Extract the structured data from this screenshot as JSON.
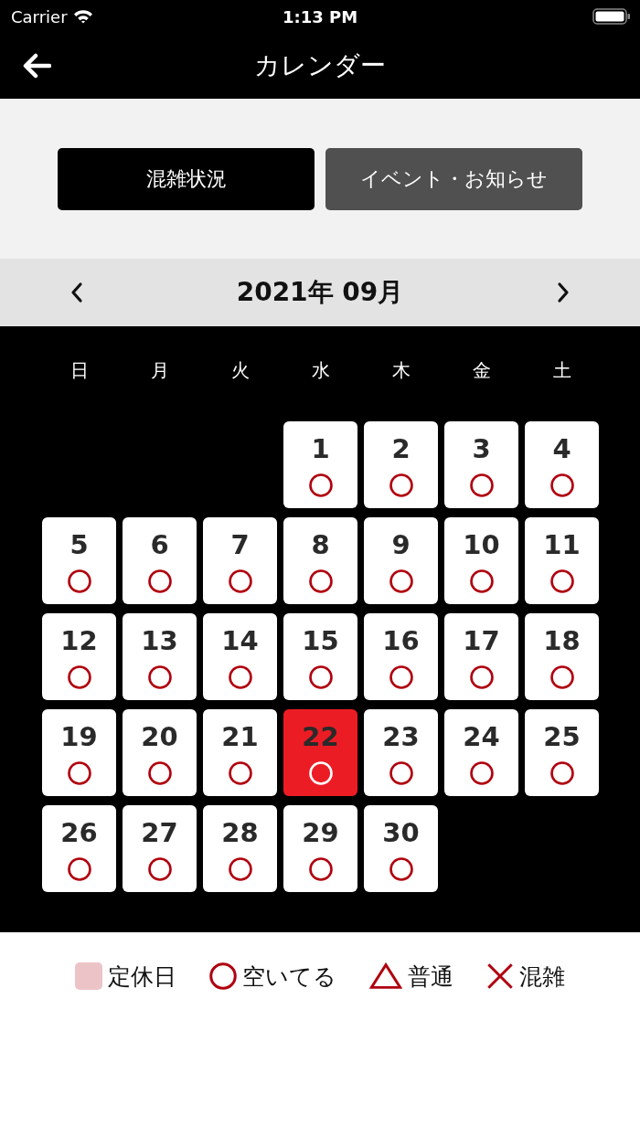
{
  "status_bar": {
    "carrier": "Carrier",
    "time": "1:13 PM"
  },
  "nav": {
    "title": "カレンダー"
  },
  "tabs": [
    {
      "label": "混雑状況",
      "selected": true
    },
    {
      "label": "イベント・お知らせ",
      "selected": false
    }
  ],
  "month": {
    "title": "2021年 09月"
  },
  "weekdays": [
    "日",
    "月",
    "火",
    "水",
    "木",
    "金",
    "土"
  ],
  "weeks": [
    [
      {
        "kind": "blank"
      },
      {
        "kind": "blank"
      },
      {
        "kind": "blank"
      },
      {
        "kind": "vacant",
        "day": "1",
        "selected": false
      },
      {
        "kind": "vacant",
        "day": "2",
        "selected": false
      },
      {
        "kind": "vacant",
        "day": "3",
        "selected": false
      },
      {
        "kind": "vacant",
        "day": "4",
        "selected": false
      }
    ],
    [
      {
        "kind": "vacant",
        "day": "5",
        "selected": false
      },
      {
        "kind": "vacant",
        "day": "6",
        "selected": false
      },
      {
        "kind": "vacant",
        "day": "7",
        "selected": false
      },
      {
        "kind": "vacant",
        "day": "8",
        "selected": false
      },
      {
        "kind": "vacant",
        "day": "9",
        "selected": false
      },
      {
        "kind": "vacant",
        "day": "10",
        "selected": false
      },
      {
        "kind": "vacant",
        "day": "11",
        "selected": false
      }
    ],
    [
      {
        "kind": "vacant",
        "day": "12",
        "selected": false
      },
      {
        "kind": "vacant",
        "day": "13",
        "selected": false
      },
      {
        "kind": "vacant",
        "day": "14",
        "selected": false
      },
      {
        "kind": "vacant",
        "day": "15",
        "selected": false
      },
      {
        "kind": "vacant",
        "day": "16",
        "selected": false
      },
      {
        "kind": "vacant",
        "day": "17",
        "selected": false
      },
      {
        "kind": "vacant",
        "day": "18",
        "selected": false
      }
    ],
    [
      {
        "kind": "vacant",
        "day": "19",
        "selected": false
      },
      {
        "kind": "vacant",
        "day": "20",
        "selected": false
      },
      {
        "kind": "vacant",
        "day": "21",
        "selected": false
      },
      {
        "kind": "vacant",
        "day": "22",
        "selected": true
      },
      {
        "kind": "vacant",
        "day": "23",
        "selected": false
      },
      {
        "kind": "vacant",
        "day": "24",
        "selected": false
      },
      {
        "kind": "vacant",
        "day": "25",
        "selected": false
      }
    ],
    [
      {
        "kind": "vacant",
        "day": "26",
        "selected": false
      },
      {
        "kind": "vacant",
        "day": "27",
        "selected": false
      },
      {
        "kind": "vacant",
        "day": "28",
        "selected": false
      },
      {
        "kind": "vacant",
        "day": "29",
        "selected": false
      },
      {
        "kind": "vacant",
        "day": "30",
        "selected": false
      }
    ]
  ],
  "legend": [
    {
      "kind": "closed",
      "label": "定休日"
    },
    {
      "kind": "vacant",
      "label": "空いてる"
    },
    {
      "kind": "normal",
      "label": "普通"
    },
    {
      "kind": "crowded",
      "label": "混雑"
    }
  ]
}
